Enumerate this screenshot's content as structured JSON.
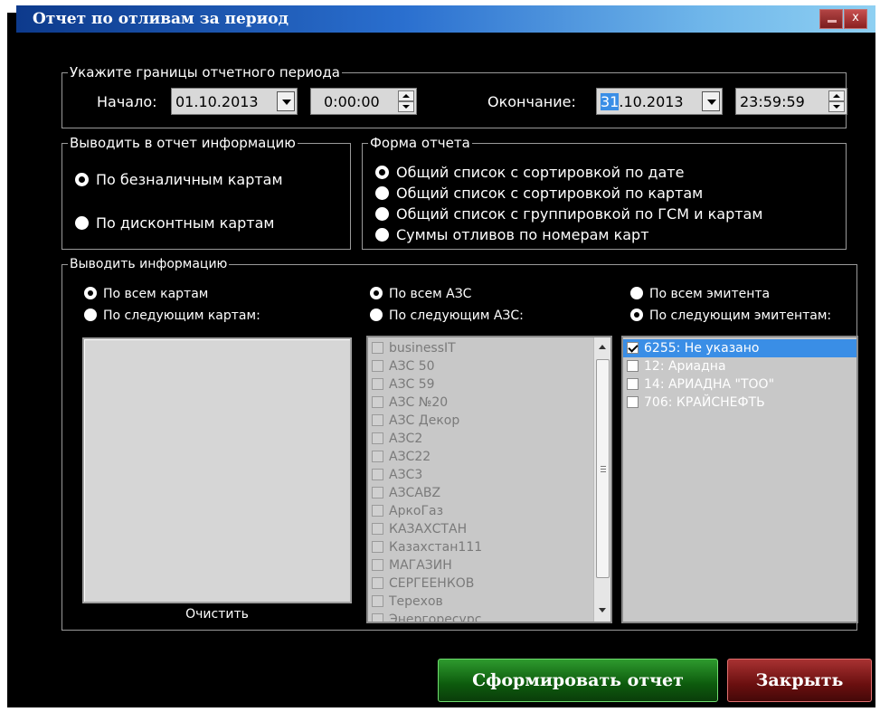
{
  "window": {
    "title": "Отчет по отливам за период",
    "minimize_label": "_",
    "close_label": "x"
  },
  "period": {
    "legend": "Укажите границы отчетного периода",
    "start_label": "Начало:",
    "start_date": "01.10.2013",
    "start_time": "0:00:00",
    "end_label": "Окончание:",
    "end_date_selected": "31",
    "end_date_rest": ".10.2013",
    "end_time": "23:59:59"
  },
  "output_info": {
    "legend": "Выводить в отчет информацию",
    "options": [
      {
        "label": "По безналичным картам",
        "selected": true
      },
      {
        "label": "По дисконтным картам",
        "selected": false
      }
    ]
  },
  "report_form": {
    "legend": "Форма отчета",
    "options": [
      {
        "label": "Общий список с сортировкой по дате",
        "selected": true
      },
      {
        "label": "Общий список с сортировкой по картам",
        "selected": false
      },
      {
        "label": "Общий список с группировкой по ГСМ и картам",
        "selected": false
      },
      {
        "label": "Суммы отливов по номерам карт",
        "selected": false
      }
    ]
  },
  "filter": {
    "legend": "Выводить информацию",
    "cards": {
      "all_label": "По всем картам",
      "some_label": "По следующим картам:",
      "clear_label": "Очистить"
    },
    "azs": {
      "all_label": "По всем АЗС",
      "some_label": "По следующим АЗС:",
      "items": [
        "businessIT",
        "АЗС 50",
        "АЗС 59",
        "АЗС №20",
        "АЗС Декор",
        "АЗС2",
        "АЗС22",
        "АЗС3",
        "АЗСABZ",
        "АркоГаз",
        "КАЗАХСТАН",
        "Казахстан111",
        "МАГАЗИН",
        "СЕРГЕЕНКОВ",
        "Терехов",
        "Энергоресурс"
      ]
    },
    "emitents": {
      "all_label": "По всем эмитента",
      "some_label": "По следующим эмитентам:",
      "items": [
        {
          "label": "6255: Не указано",
          "checked": true
        },
        {
          "label": "12: Ариадна",
          "checked": false
        },
        {
          "label": "14: АРИАДНА \"ТОО\"",
          "checked": false
        },
        {
          "label": "706: КРАЙСНЕФТЬ",
          "checked": false
        }
      ]
    }
  },
  "actions": {
    "generate_label": "Сформировать отчет",
    "close_label": "Закрыть"
  }
}
